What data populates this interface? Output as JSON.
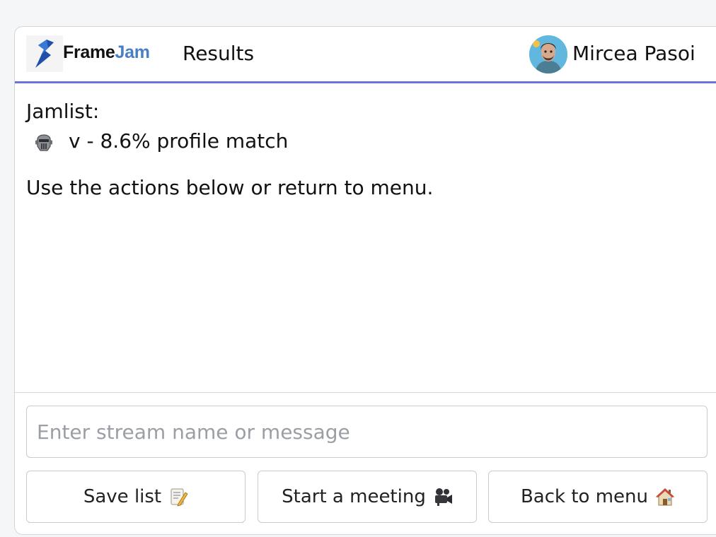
{
  "header": {
    "brand_part1": "Frame",
    "brand_part2": "Jam",
    "page_label": "Results",
    "username": "Mircea Pasoi",
    "accent_color": "#6b72d9"
  },
  "content": {
    "jamlist_label": "Jamlist:",
    "jam_items": [
      {
        "icon": "mask-icon",
        "text": "v - 8.6% profile match"
      }
    ],
    "help_text": "Use the actions below or return to menu."
  },
  "footer": {
    "input_placeholder": "Enter stream name or message",
    "input_value": "",
    "buttons": [
      {
        "label": "Save list",
        "icon": "memo-icon"
      },
      {
        "label": "Start a meeting",
        "icon": "video-camera-icon"
      },
      {
        "label": "Back to menu",
        "icon": "house-icon"
      }
    ]
  }
}
